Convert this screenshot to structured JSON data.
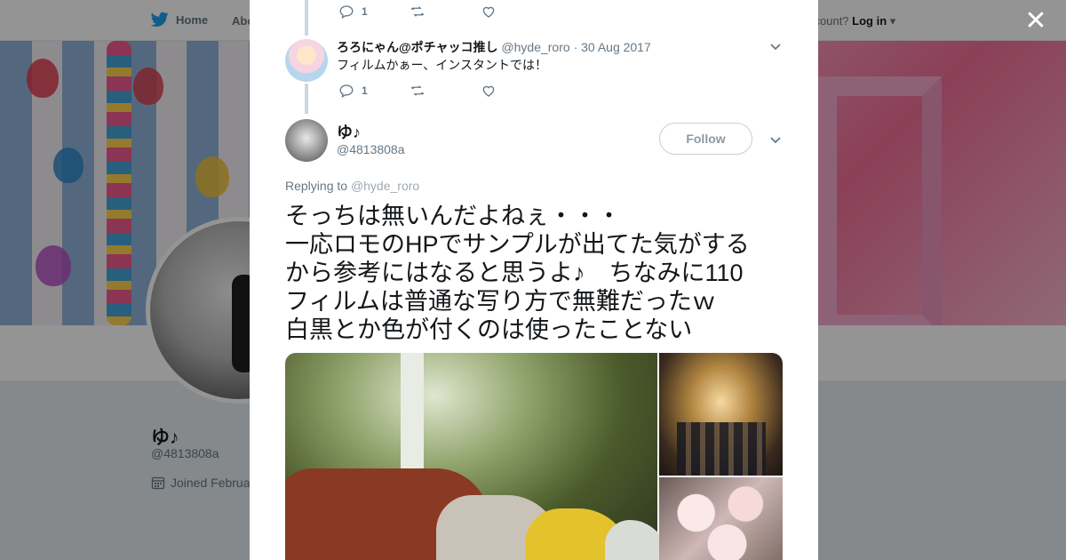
{
  "topnav": {
    "home_label": "Home",
    "about_label": "Abo",
    "account_prompt": "ccount?",
    "login_label": "Log in"
  },
  "profile": {
    "name": "ゆ♪",
    "handle": "@4813808a",
    "joined": "Joined Februa"
  },
  "modal": {
    "close_icon": "close-icon",
    "first_actions": {
      "reply_count": "1"
    },
    "reply_tweet": {
      "author_name": "ろろにゃん@ポチャッコ推し",
      "author_handle": "@hyde_roro",
      "separator": "·",
      "date": "30 Aug 2017",
      "text": "フィルムかぁー、インスタントでは！",
      "reply_count": "1"
    },
    "main_tweet": {
      "author_name": "ゆ♪",
      "author_handle": "@4813808a",
      "follow_label": "Follow",
      "replying_prefix": "Replying to",
      "replying_to": "@hyde_roro",
      "text_lines": [
        "そっちは無いんだよねぇ・・・",
        "一応ロモのHPでサンプルが出てた気がする",
        "から参考にはなると思うよ♪　ちなみに110",
        "フィルムは普通な写り方で無難だったｗ",
        "白黒とか色が付くのは使ったことない"
      ]
    }
  },
  "colors": {
    "twitter_blue": "#1da1f2",
    "secondary_text": "#657786",
    "overlay": "rgba(0,0,0,0.42)"
  }
}
